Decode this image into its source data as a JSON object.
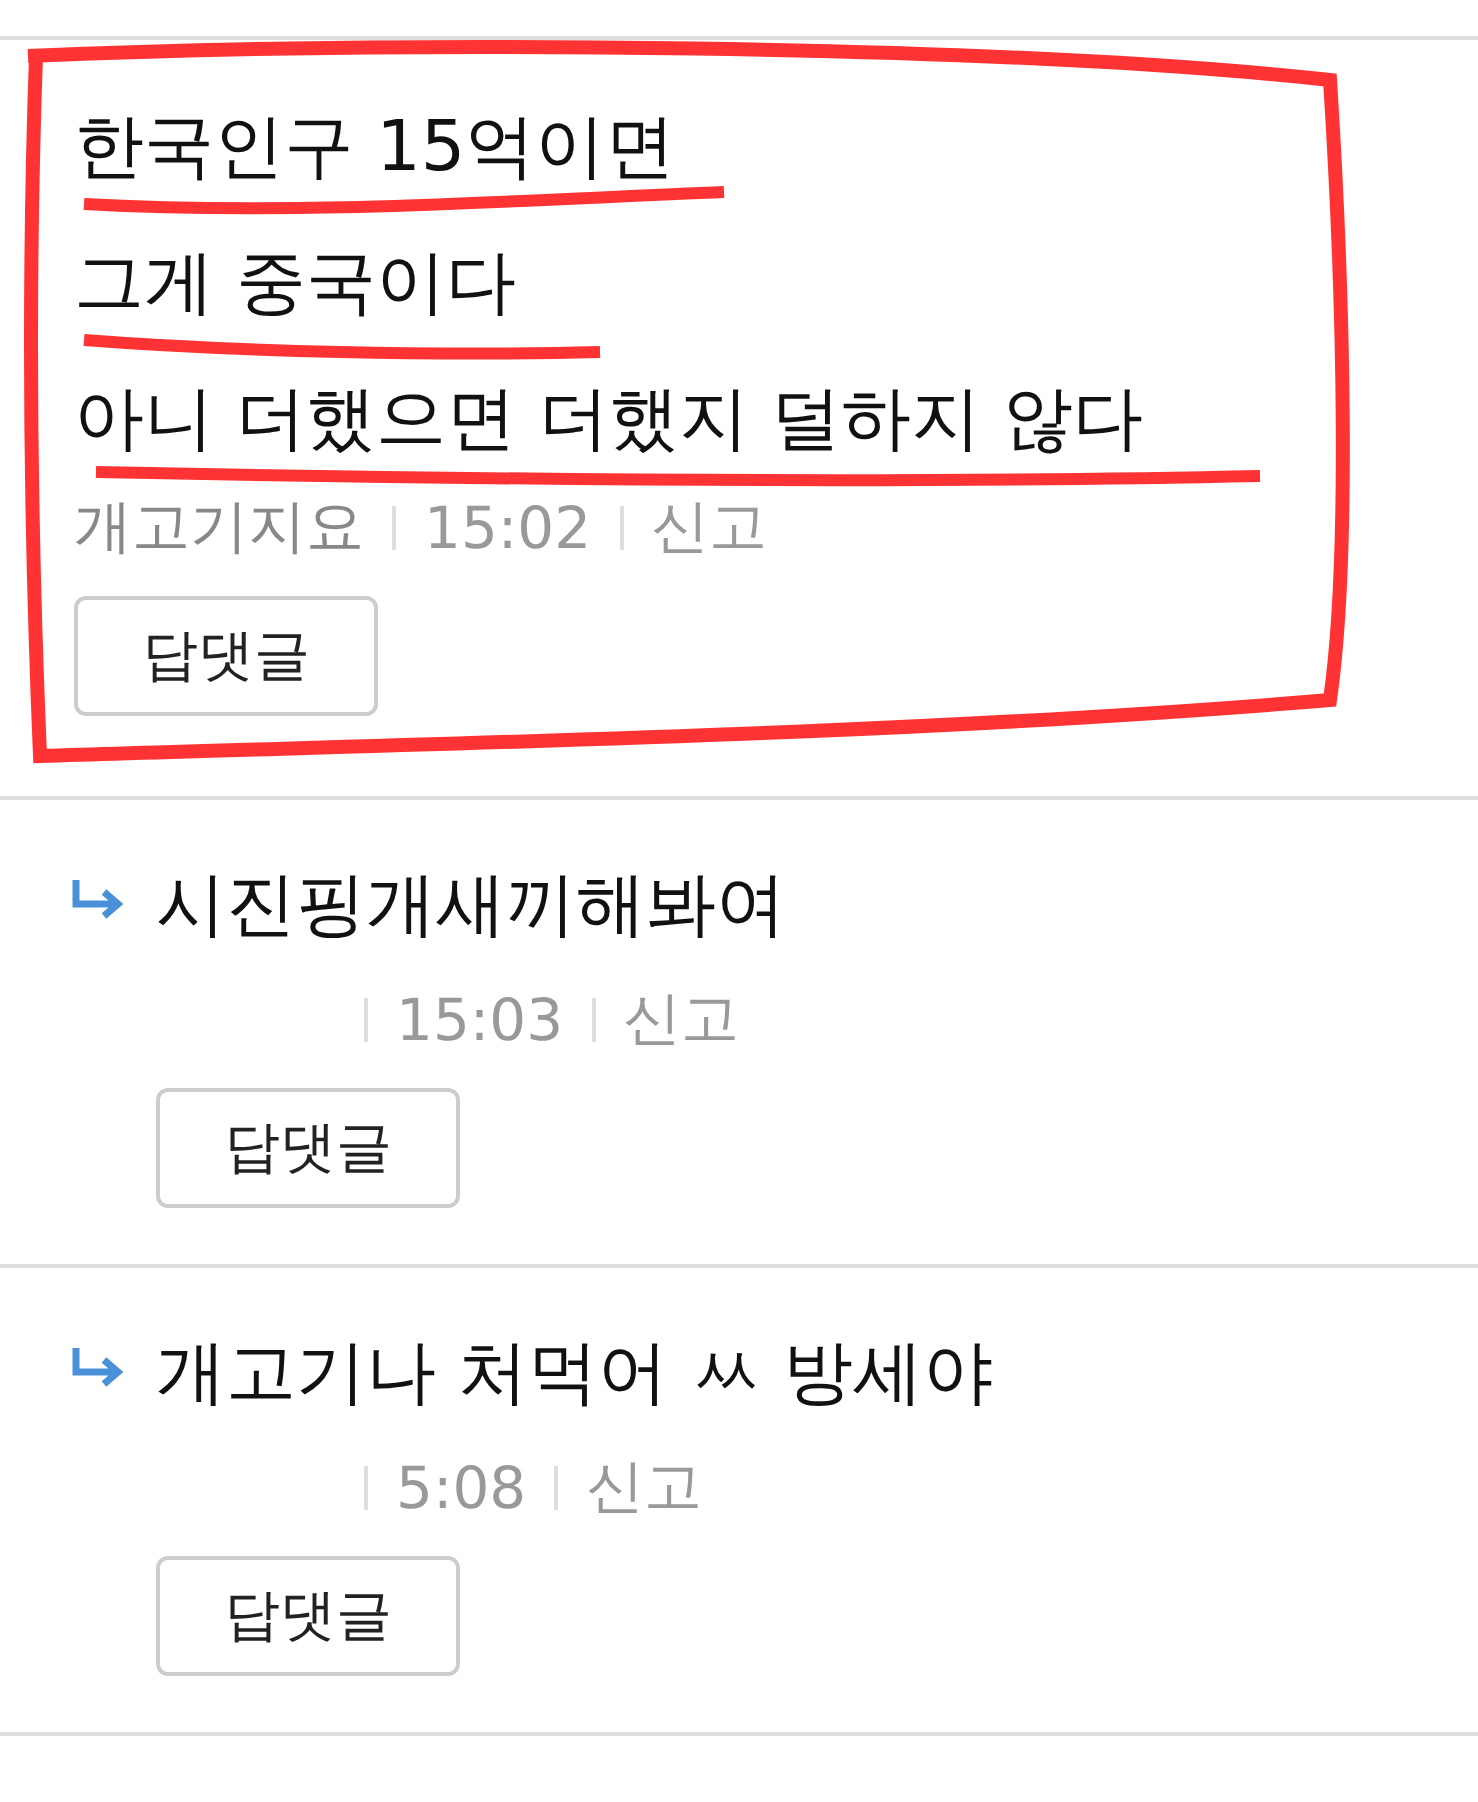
{
  "comments": [
    {
      "kind": "comment",
      "lines": [
        "한국인구 15억이면",
        "그게 중국이다",
        "아니 더했으면 더했지 덜하지 않다"
      ],
      "author": "개고기지요",
      "time": "15:02",
      "report": "신고",
      "reply_button": "답댓글"
    },
    {
      "kind": "reply",
      "lines": [
        "시진핑개새끼해봐여"
      ],
      "time": "15:03",
      "report": "신고",
      "reply_button": "답댓글"
    },
    {
      "kind": "reply",
      "lines": [
        "개고기나 처먹어 ㅆ 방세야"
      ],
      "time": "5:08",
      "report": "신고",
      "reply_button": "답댓글"
    }
  ]
}
